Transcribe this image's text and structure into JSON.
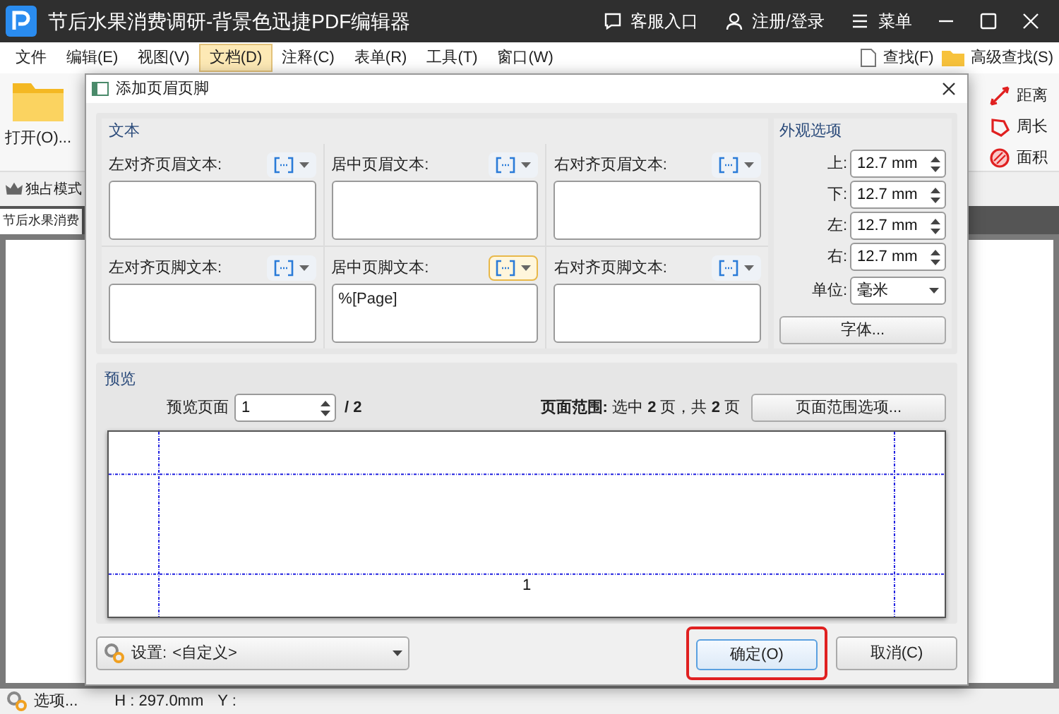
{
  "app": {
    "title": "节后水果消费调研-背景色迅捷PDF编辑器",
    "title_actions": [
      {
        "label": "客服入口",
        "kind": "chat"
      },
      {
        "label": "注册/登录",
        "kind": "user"
      },
      {
        "label": "菜单",
        "kind": "menu"
      }
    ],
    "menu": [
      {
        "label": "文件",
        "selected": false
      },
      {
        "label": "编辑(E)",
        "selected": false
      },
      {
        "label": "视图(V)",
        "selected": false
      },
      {
        "label": "文档(D)",
        "selected": true
      },
      {
        "label": "注释(C)",
        "selected": false
      },
      {
        "label": "表单(R)",
        "selected": false
      },
      {
        "label": "工具(T)",
        "selected": false
      },
      {
        "label": "窗口(W)",
        "selected": false
      }
    ],
    "search": "查找(F)",
    "advanced_search": "高级查找(S)",
    "open_label": "打开(O)...",
    "exclusive_mode": "独占模式",
    "doc_tab": "节后水果消费",
    "measure_tools": [
      {
        "label": "距离",
        "kind": "distance"
      },
      {
        "label": "周长",
        "kind": "perimeter"
      },
      {
        "label": "面积",
        "kind": "area"
      }
    ],
    "options": "选项...",
    "status": {
      "height": "H : 297.0mm",
      "y": "Y :"
    }
  },
  "dialog": {
    "title": "添加页眉页脚",
    "text_section": "文本",
    "header_fields": [
      {
        "label": "左对齐页眉文本:",
        "highlighted": false
      },
      {
        "label": "居中页眉文本:",
        "highlighted": false
      },
      {
        "label": "右对齐页眉文本:",
        "highlighted": false
      }
    ],
    "footer_fields": [
      {
        "label": "左对齐页脚文本:",
        "highlighted": false
      },
      {
        "label": "居中页脚文本:",
        "value": "%[Page]",
        "highlighted": true
      },
      {
        "label": "右对齐页脚文本:",
        "highlighted": false
      }
    ],
    "appearance": {
      "title": "外观选项",
      "margins": [
        {
          "label": "上:",
          "value": "12.7 mm"
        },
        {
          "label": "下:",
          "value": "12.7 mm"
        },
        {
          "label": "左:",
          "value": "12.7 mm"
        },
        {
          "label": "右:",
          "value": "12.7 mm"
        }
      ],
      "unit_label": "单位:",
      "unit_value": "毫米",
      "font_button": "字体..."
    },
    "preview": {
      "title": "预览",
      "page_label": "预览页面",
      "page_value": "1",
      "page_total": "/ 2",
      "range": "**页面范围:** 选中 **2** 页，共 **2** 页",
      "range_button": "页面范围选项...",
      "page_number": "1"
    },
    "settings_label": "设置:",
    "settings_value": "<自定义>",
    "ok": "确定(O)",
    "cancel": "取消(C)",
    "ok_highlighted": true
  }
}
